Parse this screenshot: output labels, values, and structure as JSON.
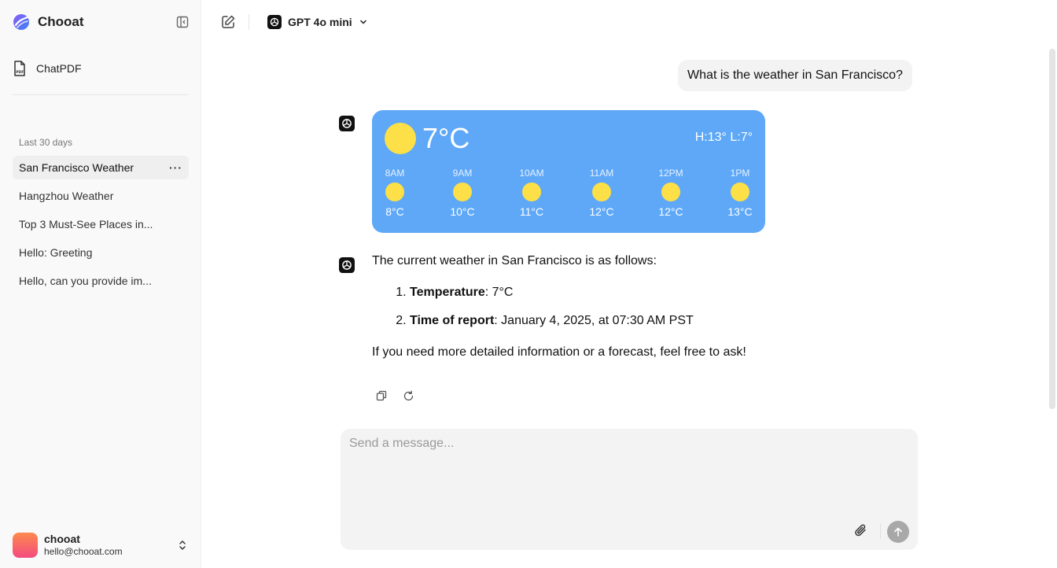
{
  "app": {
    "name": "Chooat"
  },
  "sidebar": {
    "chatpdf_label": "ChatPDF",
    "section_label": "Last 30 days",
    "history": [
      {
        "label": "San Francisco Weather",
        "active": true
      },
      {
        "label": "Hangzhou Weather"
      },
      {
        "label": "Top 3 Must-See Places in..."
      },
      {
        "label": "Hello: Greeting"
      },
      {
        "label": "Hello, can you provide im..."
      }
    ],
    "more_label": "···",
    "user": {
      "name": "chooat",
      "email": "hello@chooat.com"
    }
  },
  "topbar": {
    "model": "GPT 4o mini"
  },
  "chat": {
    "user_message": "What is the weather in San Francisco?",
    "weather": {
      "temp": "7°C",
      "high_low": "H:13° L:7°",
      "hours": [
        {
          "time": "8AM",
          "temp": "8°C"
        },
        {
          "time": "9AM",
          "temp": "10°C"
        },
        {
          "time": "10AM",
          "temp": "11°C"
        },
        {
          "time": "11AM",
          "temp": "12°C"
        },
        {
          "time": "12PM",
          "temp": "12°C"
        },
        {
          "time": "1PM",
          "temp": "13°C"
        }
      ]
    },
    "answer": {
      "intro": "The current weather in San Francisco is as follows:",
      "items": [
        {
          "term": "Temperature",
          "value": ": 7°C"
        },
        {
          "term": "Time of report",
          "value": ": January 4, 2025, at 07:30 AM PST"
        }
      ],
      "outro": "If you need more detailed information or a forecast, feel free to ask!"
    }
  },
  "composer": {
    "placeholder": "Send a message..."
  },
  "colors": {
    "weather_card": "#5ea8f7",
    "sun": "#fde047",
    "send_disabled": "#a8a8a8"
  }
}
